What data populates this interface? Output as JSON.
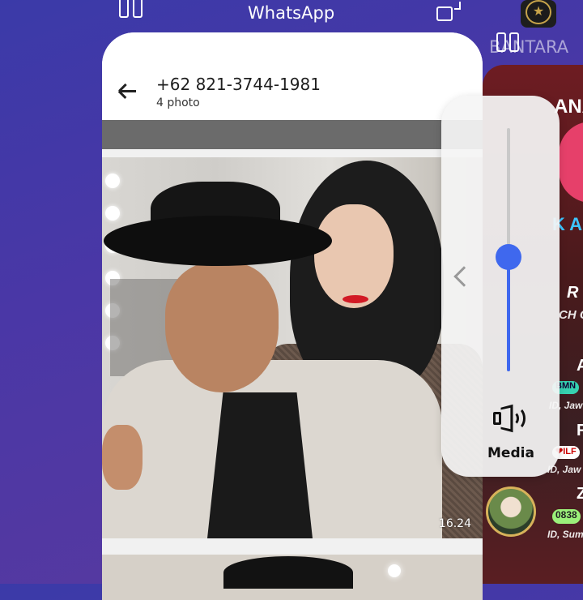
{
  "top_bar": {
    "app_label": "WhatsApp",
    "right_app_title": "BANTARA"
  },
  "whatsapp": {
    "contact": "+62 821-3744-1981",
    "photo_count": "4 photo",
    "photo_timestamp": "16.24"
  },
  "right_app": {
    "header_text": "ANA",
    "stream_text_1": "K A",
    "row1_name": "R",
    "row1_sub": "CH C",
    "row2_name": "A",
    "row2_badge": "BMN",
    "row2_sub": "ID, Jaw",
    "row3_name": "F",
    "row3_badge": "❤ILF",
    "row3_sub": "ID, Jaw",
    "row4_name": "Z",
    "row4_badge": "0838",
    "row4_sub": "ID, Sum"
  },
  "volume": {
    "label": "Media",
    "level_percent": 47
  },
  "colors": {
    "accent": "#3f68ee"
  },
  "icons": [
    "split-screen-icon",
    "floating-window-icon",
    "back-arrow-icon",
    "chevron-left-icon",
    "speaker-icon"
  ]
}
